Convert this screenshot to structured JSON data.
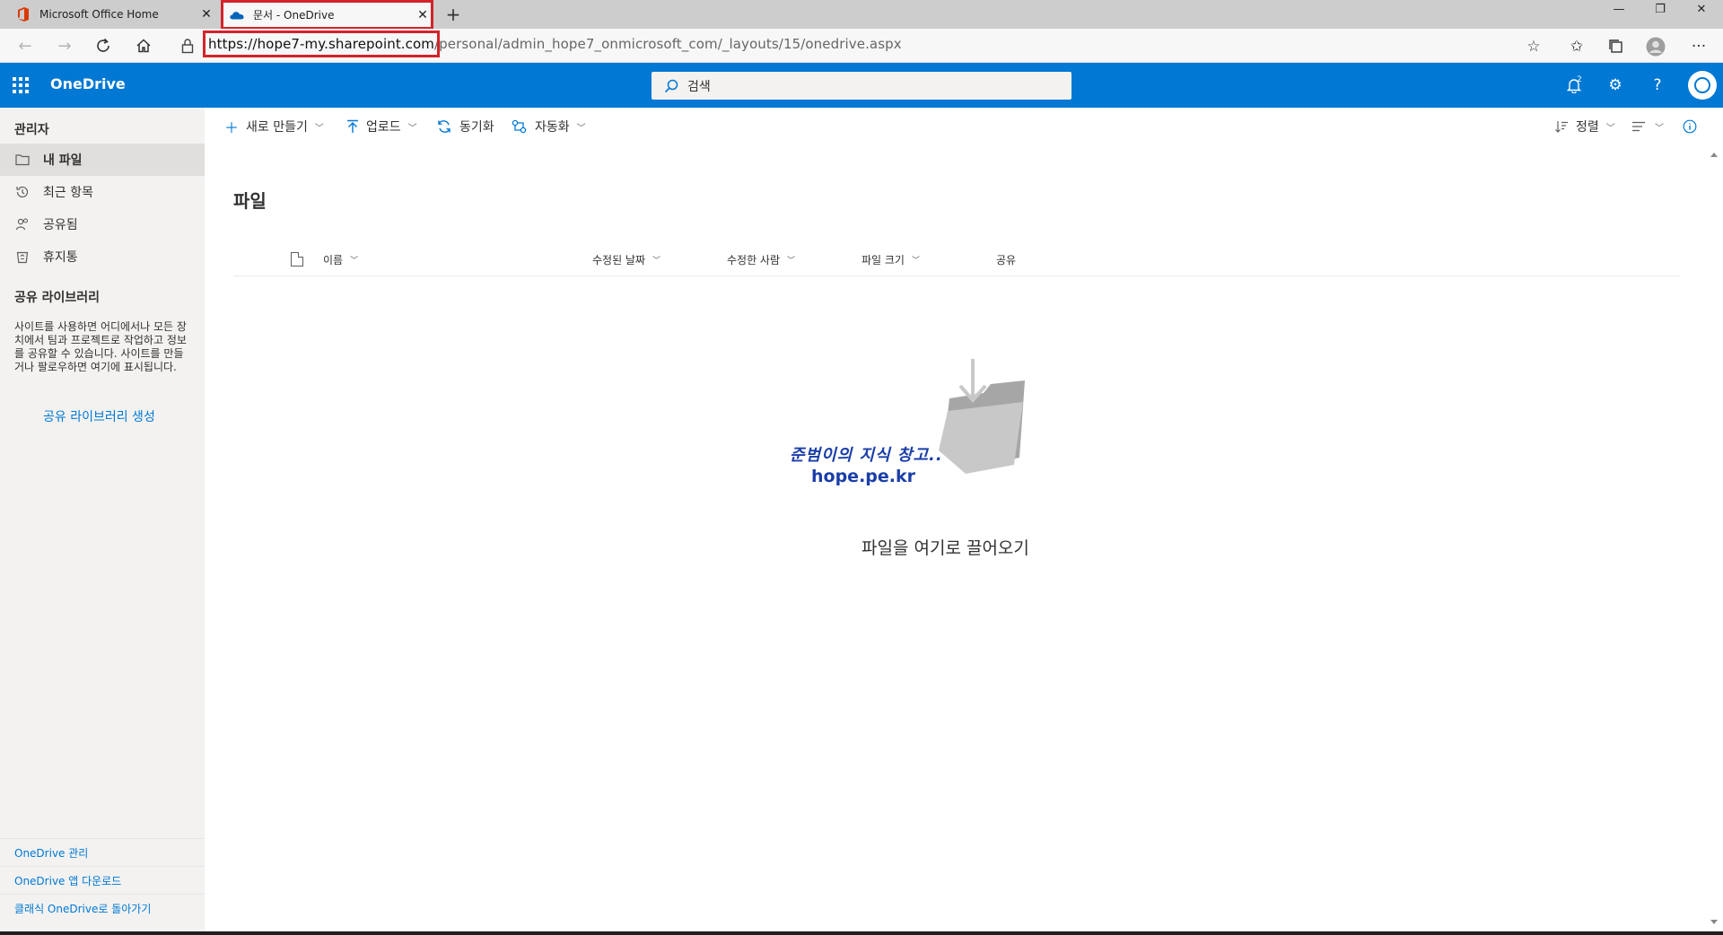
{
  "browser": {
    "tabs": [
      {
        "title": "Microsoft Office Home",
        "icon": "office-icon"
      },
      {
        "title": "문서 - OneDrive",
        "icon": "onedrive-cloud-icon"
      }
    ],
    "new_tab": "+",
    "url_host": "https://hope7-my.sharepoint.com",
    "url_path": "/personal/admin_hope7_onmicrosoft_com/_layouts/15/onedrive.aspx",
    "highlight_color": "#d3232a"
  },
  "suite": {
    "brand": "OneDrive",
    "search_placeholder": "검색",
    "notification_count": "2",
    "accent": "#0078d4"
  },
  "sidebar": {
    "user": "관리자",
    "items": [
      {
        "label": "내 파일",
        "icon": "folder-icon"
      },
      {
        "label": "최근 항목",
        "icon": "history-icon"
      },
      {
        "label": "공유됨",
        "icon": "people-icon"
      },
      {
        "label": "휴지통",
        "icon": "recycle-bin-icon"
      }
    ],
    "shared_title": "공유 라이브러리",
    "shared_desc": "사이트를 사용하면 어디에서나 모든 장치에서 팀과 프로젝트로 작업하고 정보를 공유할 수 있습니다. 사이트를 만들거나 팔로우하면 여기에 표시됩니다.",
    "shared_create": "공유 라이브러리 생성",
    "footer": [
      "OneDrive 관리",
      "OneDrive 앱 다운로드",
      "클래식 OneDrive로 돌아가기"
    ]
  },
  "commands": {
    "new": "새로 만들기",
    "upload": "업로드",
    "sync": "동기화",
    "automate": "자동화",
    "sort": "정렬"
  },
  "main": {
    "title": "파일",
    "columns": [
      "이름",
      "수정된 날짜",
      "수정한 사람",
      "파일 크기",
      "공유"
    ],
    "empty_text": "파일을 여기로 끌어오기",
    "watermark_line1": "준범이의 지식 창고..",
    "watermark_line2": "hope.pe.kr"
  }
}
